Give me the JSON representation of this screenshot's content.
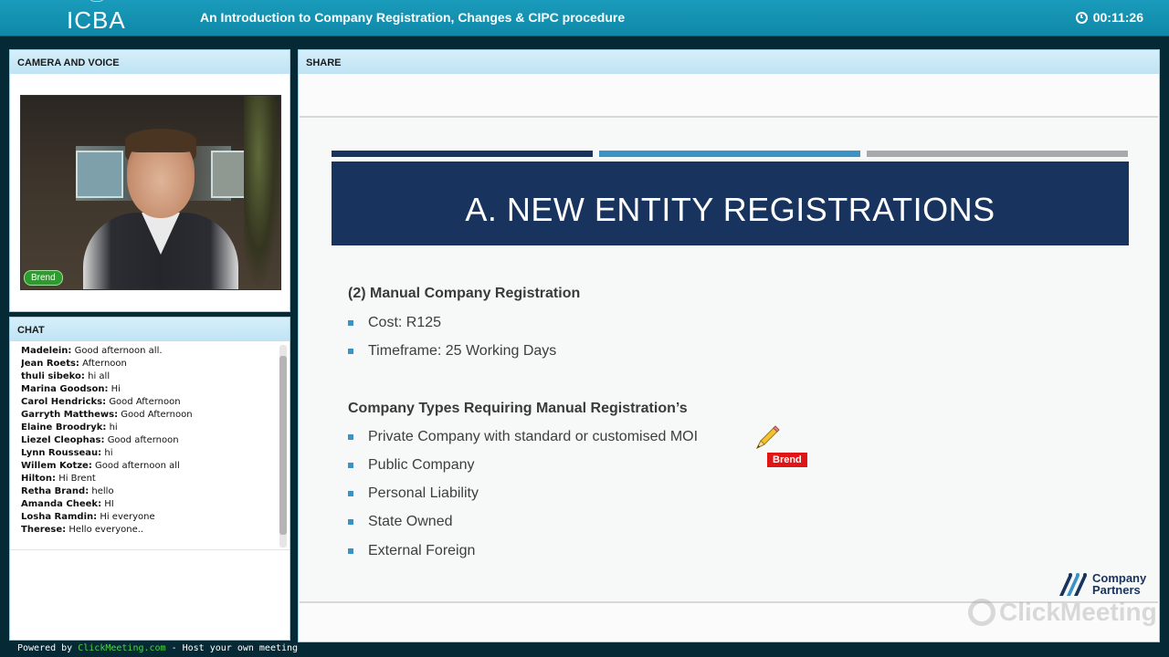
{
  "header": {
    "logo": "ICBA",
    "title": "An Introduction to Company Registration, Changes & CIPC procedure",
    "timer": "00:11:26"
  },
  "camera_panel": {
    "title": "CAMERA AND VOICE",
    "presenter_name": "Brend"
  },
  "chat_panel": {
    "title": "CHAT",
    "messages": [
      {
        "author": "Madelein:",
        "text": "Good afternoon all."
      },
      {
        "author": "Jean Roets:",
        "text": "Afternoon"
      },
      {
        "author": "thuli sibeko:",
        "text": "hi all"
      },
      {
        "author": "Marina Goodson:",
        "text": "Hi"
      },
      {
        "author": "Carol Hendricks:",
        "text": "Good Afternoon"
      },
      {
        "author": "Garryth Matthews:",
        "text": "Good Afternoon"
      },
      {
        "author": "Elaine Broodryk:",
        "text": "hi"
      },
      {
        "author": "Liezel Cleophas:",
        "text": "Good afternoon"
      },
      {
        "author": "Lynn Rousseau:",
        "text": "hi"
      },
      {
        "author": "Willem Kotze:",
        "text": "Good afternoon all"
      },
      {
        "author": "Hilton:",
        "text": "Hi Brent"
      },
      {
        "author": "Retha Brand:",
        "text": "hello"
      },
      {
        "author": "Amanda Cheek:",
        "text": "HI"
      },
      {
        "author": "Losha Ramdin:",
        "text": "Hi everyone"
      },
      {
        "author": "Therese:",
        "text": "Hello everyone.."
      }
    ]
  },
  "footer": {
    "prefix": "Powered by ",
    "link": "ClickMeeting.com",
    "suffix": " - Host your own meeting"
  },
  "share_panel": {
    "title": "SHARE",
    "slide": {
      "banner_title": "A. NEW ENTITY REGISTRATIONS",
      "section1_title": "(2) Manual Company Registration",
      "section1_bullets": [
        "Cost: R125",
        "Timeframe: 25 Working Days"
      ],
      "section2_title": "Company Types Requiring Manual Registration’s",
      "section2_bullets": [
        "Private Company with standard or customised MOI",
        "Public Company",
        "Personal Liability",
        "State Owned",
        "External Foreign"
      ],
      "pointer_label": "Brend",
      "brand_line1": "Company",
      "brand_line2": "Partners"
    },
    "watermark": "ClickMeeting"
  },
  "colors": {
    "topbar": "#1a9bbb",
    "slide_banner": "#17335e",
    "accent_blue": "#3a93c4",
    "pointer_red": "#e01515",
    "presenter_tag_green": "#2e9b2e"
  }
}
